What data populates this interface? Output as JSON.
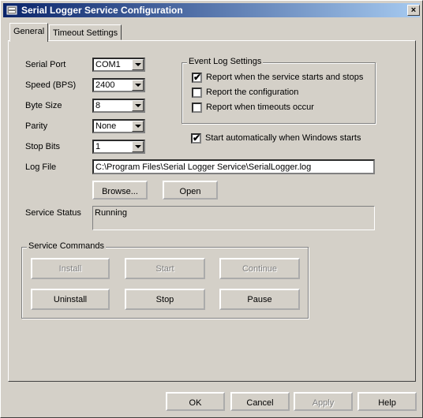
{
  "window": {
    "title": "Serial Logger Service Configuration",
    "close_label": "×"
  },
  "tabs": [
    {
      "label": "General",
      "active": true
    },
    {
      "label": "Timeout Settings",
      "active": false
    }
  ],
  "settings": {
    "serial_port": {
      "label": "Serial Port",
      "value": "COM1"
    },
    "speed": {
      "label": "Speed (BPS)",
      "value": "2400"
    },
    "byte_size": {
      "label": "Byte Size",
      "value": "8"
    },
    "parity": {
      "label": "Parity",
      "value": "None"
    },
    "stop_bits": {
      "label": "Stop Bits",
      "value": "1"
    }
  },
  "event_log": {
    "title": "Event Log Settings",
    "items": [
      {
        "label": "Report when the service starts and stops",
        "checked": true
      },
      {
        "label": "Report the configuration",
        "checked": false
      },
      {
        "label": "Report when timeouts occur",
        "checked": false
      }
    ]
  },
  "autostart": {
    "label": "Start automatically when Windows starts",
    "checked": true
  },
  "log_file": {
    "label": "Log File",
    "value": "C:\\Program Files\\Serial Logger Service\\SerialLogger.log",
    "browse_label": "Browse...",
    "open_label": "Open"
  },
  "service_status": {
    "label": "Service Status",
    "value": "Running"
  },
  "commands": {
    "title": "Service Commands",
    "install": "Install",
    "start": "Start",
    "continue": "Continue",
    "uninstall": "Uninstall",
    "stop": "Stop",
    "pause": "Pause"
  },
  "footer": {
    "ok": "OK",
    "cancel": "Cancel",
    "apply": "Apply",
    "help": "Help"
  },
  "check_mark": "✔",
  "colors": {
    "titlebar_start": "#0a246a",
    "titlebar_end": "#a6caf0",
    "face": "#d4d0c8"
  }
}
